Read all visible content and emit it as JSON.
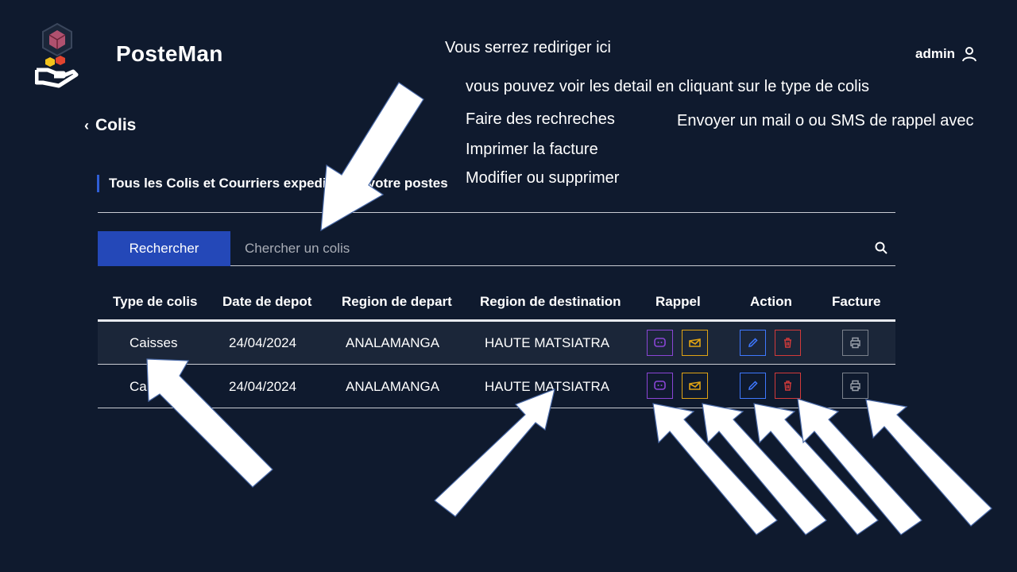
{
  "header": {
    "brand": "PosteMan",
    "user": "admin"
  },
  "page": {
    "back_label": "Colis",
    "section_title": "Tous les Colis et Courriers expedier par votre postes"
  },
  "search": {
    "button_label": "Rechercher",
    "placeholder": "Chercher un colis"
  },
  "table": {
    "columns": [
      "Type de colis",
      "Date de depot",
      "Region de depart",
      "Region de destination",
      "Rappel",
      "Action",
      "Facture"
    ],
    "rows": [
      {
        "type": "Caisses",
        "date": "24/04/2024",
        "depart": "ANALAMANGA",
        "destination": "HAUTE MATSIATRA"
      },
      {
        "type": "Caisses",
        "date": "24/04/2024",
        "depart": "ANALAMANGA",
        "destination": "HAUTE MATSIATRA"
      }
    ]
  },
  "annotations": {
    "redirect": "Vous serrez rediriger ici",
    "details": "vous pouvez voir les detail en cliquant sur le type de colis",
    "search": "Faire des rechreches",
    "reminder": "Envoyer un mail o ou SMS de rappel avec",
    "print": "Imprimer la facture",
    "edit": "Modifier ou supprimer"
  },
  "colors": {
    "background": "#0f1a2e",
    "primary": "#2448b8",
    "sms": "#8a45d6",
    "mail": "#e0a313",
    "edit": "#3e78ff",
    "delete": "#d33a3a",
    "print": "#7b818c"
  }
}
